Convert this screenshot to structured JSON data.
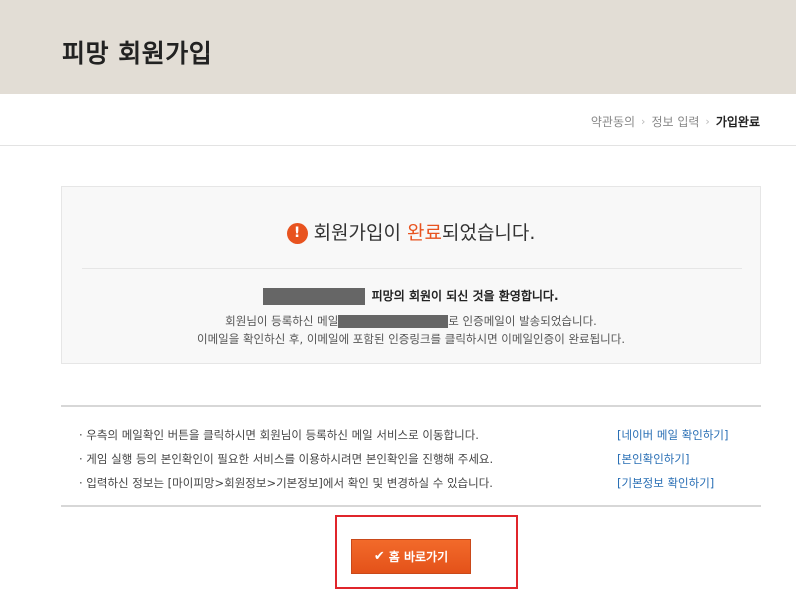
{
  "header": {
    "title": "피망 회원가입"
  },
  "steps": [
    {
      "label": "약관동의"
    },
    {
      "label": "정보 입력"
    },
    {
      "label": "가입완료"
    }
  ],
  "step_separator": "›",
  "complete_box": {
    "headline_pre": "회원가입이 ",
    "headline_highlight": "완료",
    "headline_post": "되었습니다.",
    "alert_icon_glyph": "!",
    "welcome_text": " 피망의 회원이 되신 것을 환영합니다.",
    "line2_pre": "회원님이 등록하신 메일",
    "line2_post": "로 인증메일이 발송되었습니다.",
    "line3": "이메일을 확인하신 후, 이메일에 포함된 인증링크를 클릭하시면 이메일인증이 완료됩니다."
  },
  "notices": [
    {
      "text": "· 우측의 메일확인 버튼을 클릭하시면 회원님이 등록하신 메일 서비스로 이동합니다.",
      "link": "[네이버 메일 확인하기]"
    },
    {
      "text": "· 게임 실행 등의 본인확인이 필요한 서비스를 이용하시려면 본인확인을 진행해 주세요.",
      "link": "[본인확인하기]"
    },
    {
      "text": "· 입력하신 정보는 [마이피망>회원정보>기본정보]에서 확인 및 변경하실 수 있습니다.",
      "link": "[기본정보 확인하기]"
    }
  ],
  "home_button": {
    "icon": "✔",
    "label": "홈 바로가기"
  },
  "colors": {
    "accent": "#e8531f",
    "link": "#2a6fb5",
    "header_bg": "#e2ddd5",
    "highlight_border": "#e0252b"
  }
}
